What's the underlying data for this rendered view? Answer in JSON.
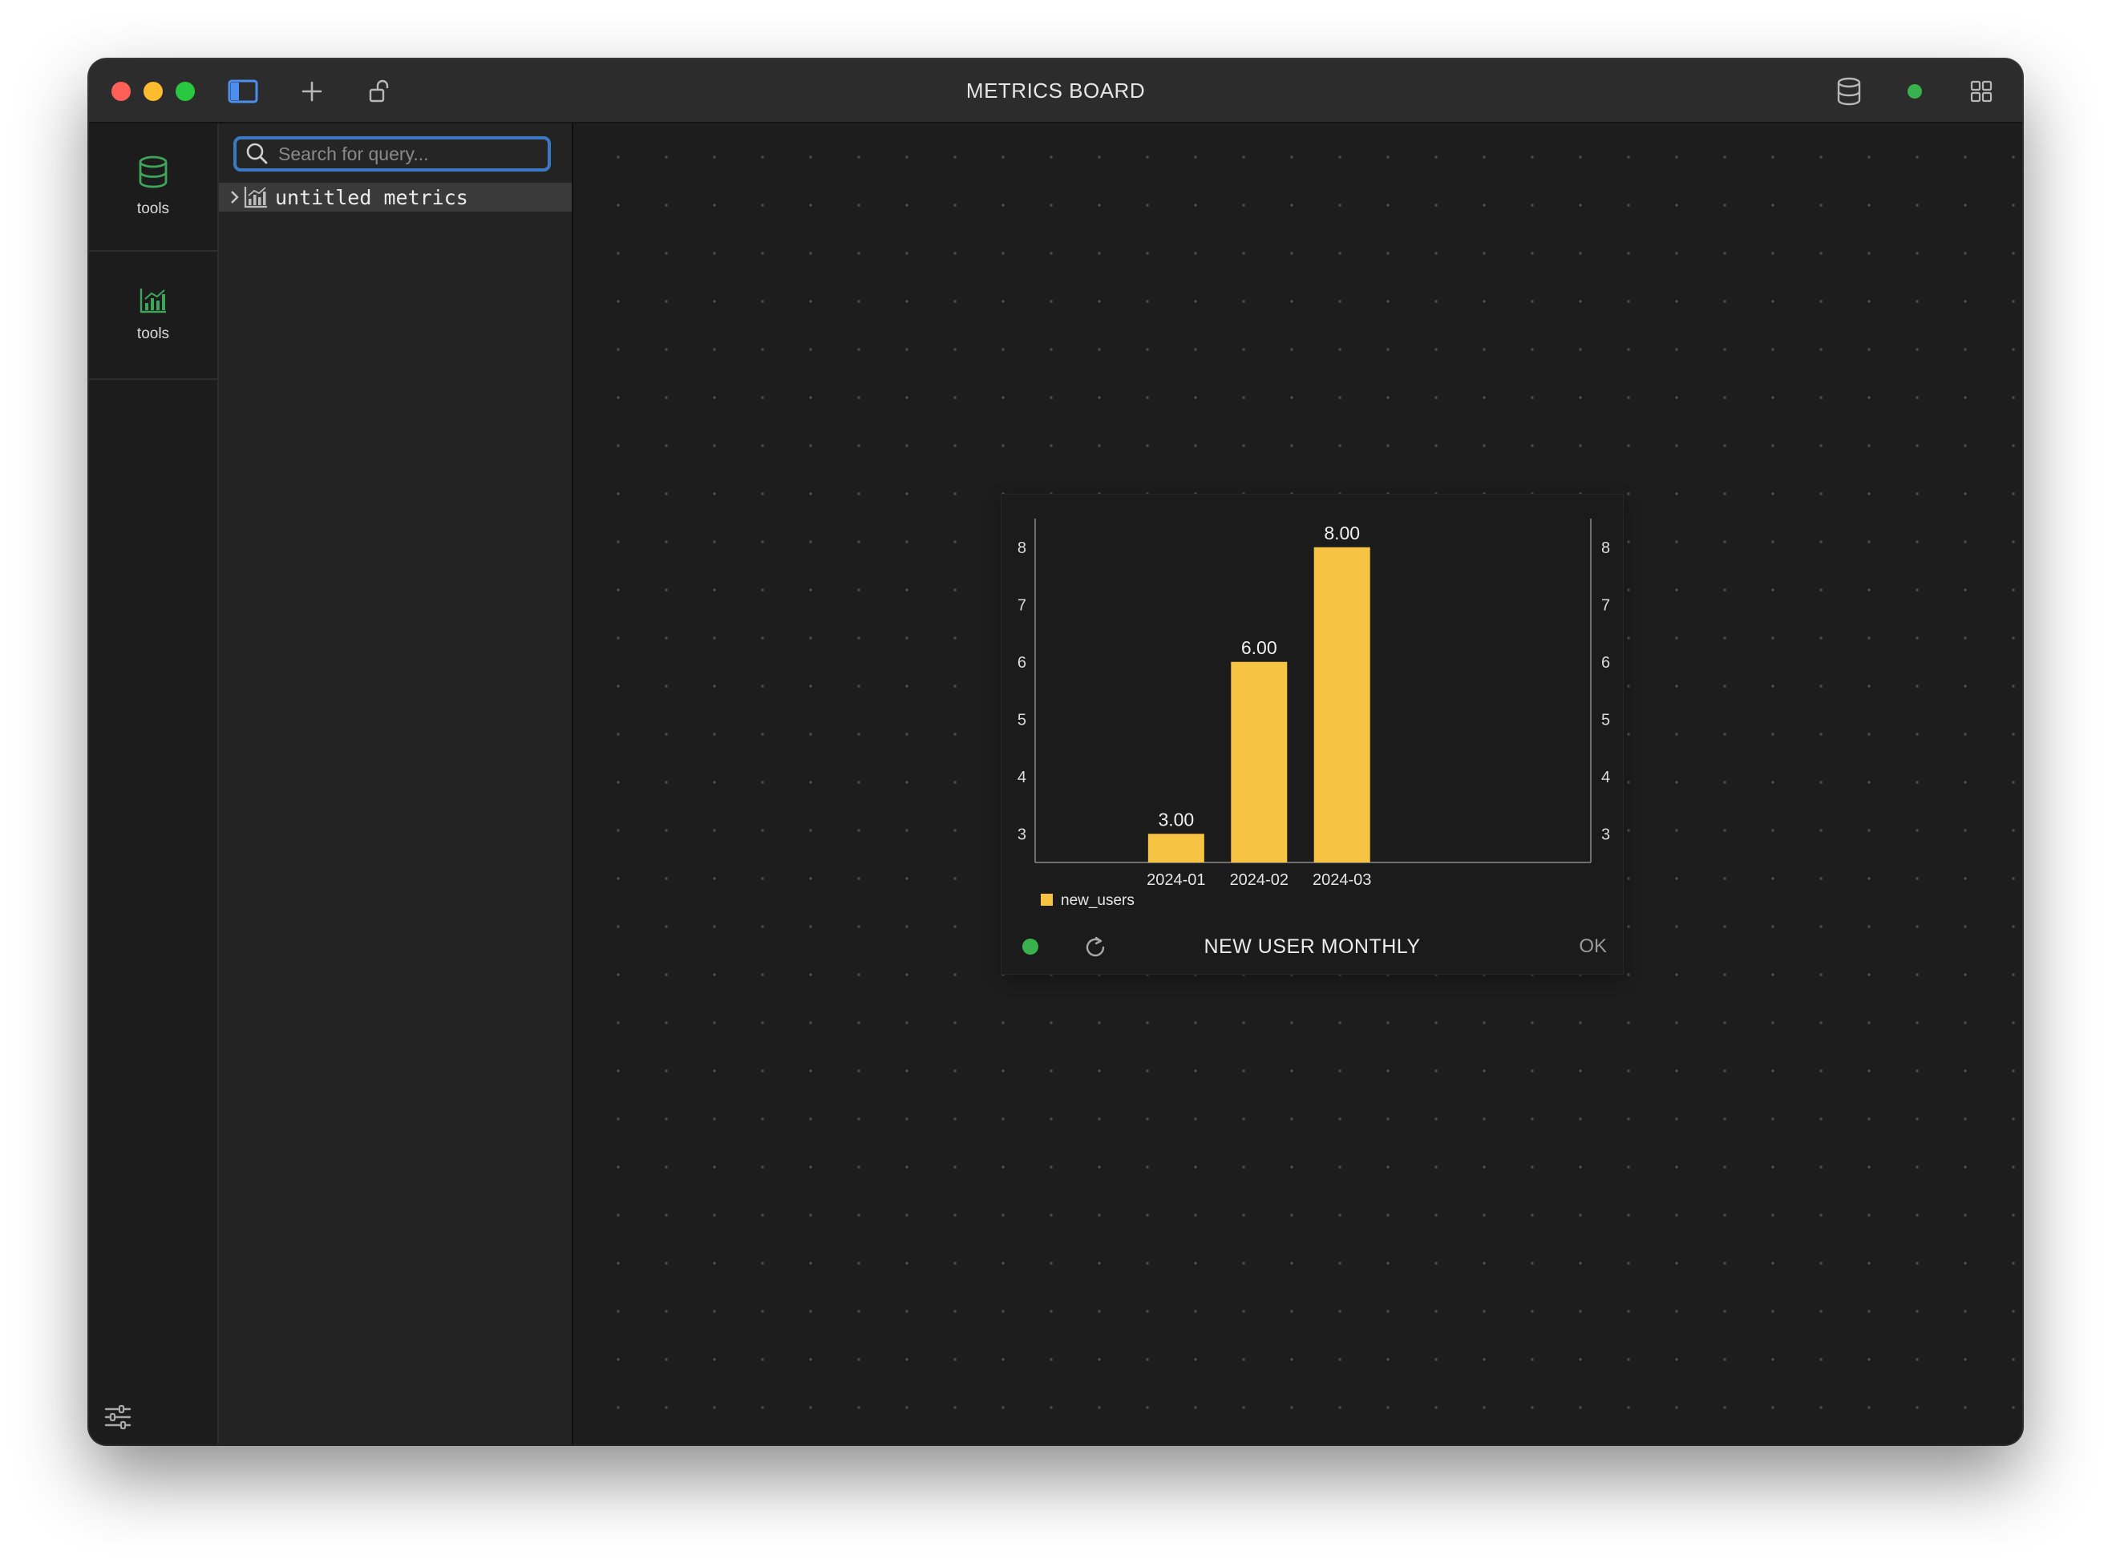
{
  "window": {
    "title": "METRICS BOARD",
    "colors": {
      "close": "#fe5f57",
      "minimize": "#febc2e",
      "zoom": "#28c840",
      "status": "#37b24d"
    }
  },
  "toolbar": {
    "icons": [
      "sidebar-toggle-icon",
      "plus-icon",
      "unlock-icon",
      "database-icon",
      "status-dot",
      "grid-icon"
    ]
  },
  "rail": {
    "items": [
      {
        "label": "tools",
        "icon": "database-icon"
      },
      {
        "label": "tools",
        "icon": "bar-chart-icon"
      }
    ],
    "settings_icon": "sliders-icon"
  },
  "sidebar": {
    "search": {
      "placeholder": "Search for query...",
      "value": ""
    },
    "tree": [
      {
        "label": "untitled metrics",
        "icon": "chart-icon",
        "expanded": false
      }
    ]
  },
  "card": {
    "title": "NEW USER MONTHLY",
    "ok_label": "OK",
    "status_color": "#37b24d"
  },
  "chart_data": {
    "type": "bar",
    "categories": [
      "2024-01",
      "2024-02",
      "2024-03"
    ],
    "series": [
      {
        "name": "new_users",
        "values": [
          3,
          6,
          8
        ],
        "color": "#f6c343"
      }
    ],
    "data_labels": [
      "3.00",
      "6.00",
      "8.00"
    ],
    "y_ticks": [
      3,
      4,
      5,
      6,
      7,
      8
    ],
    "ylim": [
      2.5,
      8.5
    ],
    "dual_y_axis": true,
    "grid": false,
    "legend": "bottom-left"
  }
}
